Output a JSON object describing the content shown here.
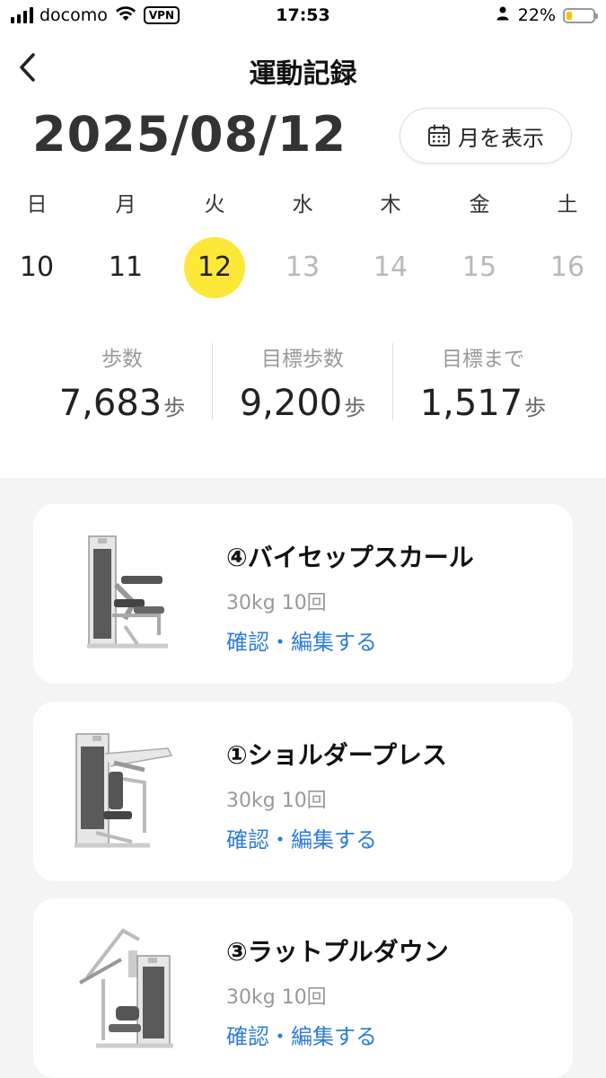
{
  "status_bar": {
    "carrier": "docomo",
    "vpn": "VPN",
    "time": "17:53",
    "battery": "22%",
    "battery_level": 0.22
  },
  "header": {
    "title": "運動記録"
  },
  "date": {
    "current": "2025/08/12",
    "month_button": "月を表示"
  },
  "week": [
    {
      "dow": "日",
      "num": "10",
      "state": "past"
    },
    {
      "dow": "月",
      "num": "11",
      "state": "past"
    },
    {
      "dow": "火",
      "num": "12",
      "state": "selected"
    },
    {
      "dow": "水",
      "num": "13",
      "state": "future"
    },
    {
      "dow": "木",
      "num": "14",
      "state": "future"
    },
    {
      "dow": "金",
      "num": "15",
      "state": "future"
    },
    {
      "dow": "土",
      "num": "16",
      "state": "future"
    }
  ],
  "stats": [
    {
      "label": "歩数",
      "value": "7,683",
      "unit": "歩"
    },
    {
      "label": "目標歩数",
      "value": "9,200",
      "unit": "歩"
    },
    {
      "label": "目標まで",
      "value": "1,517",
      "unit": "歩"
    }
  ],
  "exercises": [
    {
      "title": "④バイセップスカール",
      "detail": "30kg 10回",
      "link": "確認・編集する",
      "icon": "bicep-curl-machine-icon"
    },
    {
      "title": "①ショルダープレス",
      "detail": "30kg 10回",
      "link": "確認・編集する",
      "icon": "shoulder-press-machine-icon"
    },
    {
      "title": "③ラットプルダウン",
      "detail": "30kg 10回",
      "link": "確認・編集する",
      "icon": "lat-pulldown-machine-icon"
    }
  ],
  "colors": {
    "accent_yellow": "#fde83a",
    "link_blue": "#2f7dd4",
    "list_background": "#f4f4f4"
  }
}
